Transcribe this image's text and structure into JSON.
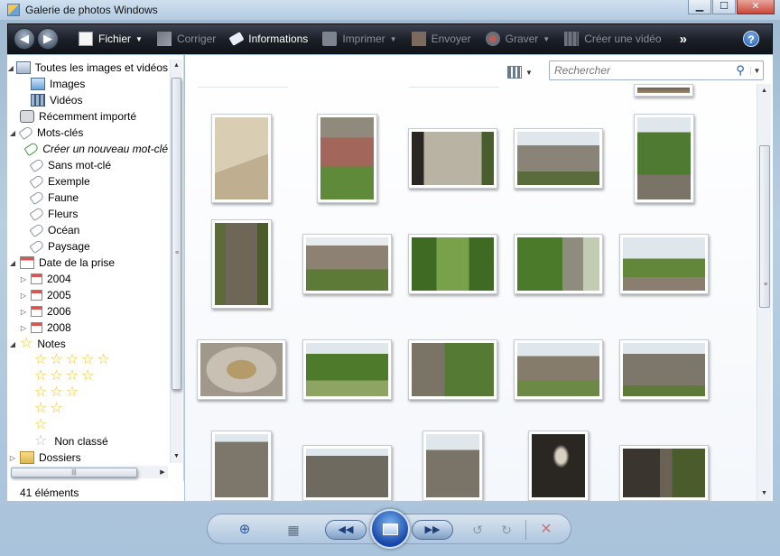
{
  "window": {
    "title": "Galerie de photos Windows",
    "controls": {
      "minimize": "▁",
      "maximize": "☐",
      "close": "✕"
    }
  },
  "toolbar": {
    "back": "◀",
    "forward": "▶",
    "items": {
      "file": "Fichier",
      "fix": "Corriger",
      "info": "Informations",
      "print": "Imprimer",
      "email": "Envoyer",
      "burn": "Graver",
      "movie": "Créer une vidéo"
    },
    "more": "»",
    "help": "?"
  },
  "sidebar": {
    "all_items": "Toutes les images et vidéos",
    "images": "Images",
    "videos": "Vidéos",
    "recent": "Récemment importé",
    "tags": "Mots-clés",
    "tag_create": "Créer un nouveau mot-clé",
    "tag_none": "Sans mot-clé",
    "tag_example": "Exemple",
    "tag_fauna": "Faune",
    "tag_flowers": "Fleurs",
    "tag_ocean": "Océan",
    "tag_landscape": "Paysage",
    "date_taken": "Date de la prise",
    "years": [
      "2004",
      "2005",
      "2006",
      "2008"
    ],
    "ratings": "Notes",
    "rating_stars": [
      5,
      4,
      3,
      2,
      1
    ],
    "unrated": "Non classé",
    "folders": "Dossiers"
  },
  "status": {
    "count": "41 éléments"
  },
  "search": {
    "placeholder": "Rechercher"
  },
  "photo_colors": {
    "stone": "#8a8478",
    "grass": "#5f8a3a",
    "sky": "#dfe6ec",
    "dark": "#2a2622"
  },
  "bottom": {
    "zoom": "⊕",
    "grid": "▦",
    "prev": "◀◀",
    "next": "▶▶",
    "rotate_left": "↺",
    "rotate_right": "↻",
    "delete": "✕"
  }
}
